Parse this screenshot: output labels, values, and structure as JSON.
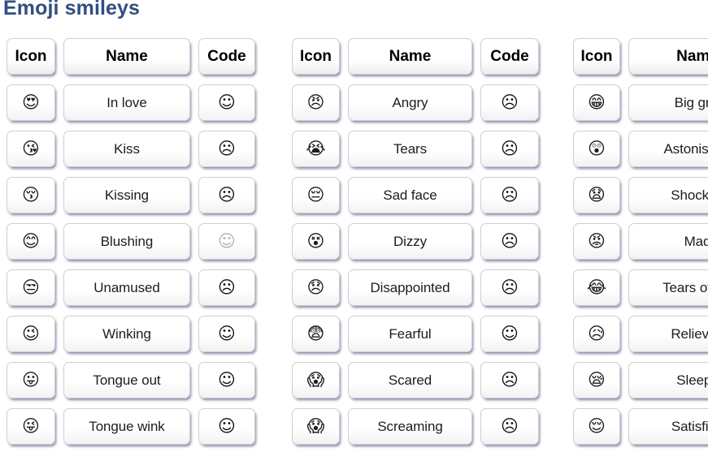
{
  "page": {
    "title": "Emoji smileys",
    "title_color": "#2f4f7f",
    "background": "#ffffff"
  },
  "columns": {
    "icon_header": "Icon",
    "name_header": "Name",
    "code_header": "Code"
  },
  "tables": [
    {
      "headers": {
        "icon": "Icon",
        "name": "Name",
        "code": "Code"
      },
      "show_code": true,
      "rows": [
        {
          "icon": "😍",
          "icon_name": "smiling-face-with-heart-eyes-icon",
          "name": "In love",
          "code": "☺",
          "code_name": "code-glyph-in-love",
          "faint": false
        },
        {
          "icon": "😘",
          "icon_name": "face-blowing-a-kiss-icon",
          "name": "Kiss",
          "code": "☹",
          "code_name": "code-glyph-kiss",
          "faint": false
        },
        {
          "icon": "😚",
          "icon_name": "kissing-face-closed-eyes-icon",
          "name": "Kissing",
          "code": "☹",
          "code_name": "code-glyph-kissing",
          "faint": false
        },
        {
          "icon": "😊",
          "icon_name": "smiling-face-blushing-icon",
          "name": "Blushing",
          "code": "☺",
          "code_name": "code-glyph-blushing",
          "faint": true
        },
        {
          "icon": "😒",
          "icon_name": "unamused-face-icon",
          "name": "Unamused",
          "code": "☹",
          "code_name": "code-glyph-unamused",
          "faint": false
        },
        {
          "icon": "😉",
          "icon_name": "winking-face-icon",
          "name": "Winking",
          "code": "☺",
          "code_name": "code-glyph-winking",
          "faint": false
        },
        {
          "icon": "😛",
          "icon_name": "face-with-tongue-icon",
          "name": "Tongue out",
          "code": "☺",
          "code_name": "code-glyph-tongue-out",
          "faint": false
        },
        {
          "icon": "😜",
          "icon_name": "winking-face-with-tongue-icon",
          "name": "Tongue wink",
          "code": "☺",
          "code_name": "code-glyph-tongue-wink",
          "faint": false
        }
      ]
    },
    {
      "headers": {
        "icon": "Icon",
        "name": "Name",
        "code": "Code"
      },
      "show_code": true,
      "rows": [
        {
          "icon": "😠",
          "icon_name": "angry-face-icon",
          "name": "Angry",
          "code": "☹",
          "code_name": "code-glyph-angry",
          "faint": false
        },
        {
          "icon": "😭",
          "icon_name": "loudly-crying-face-icon",
          "name": "Tears",
          "code": "☹",
          "code_name": "code-glyph-tears",
          "faint": false
        },
        {
          "icon": "😔",
          "icon_name": "pensive-face-icon",
          "name": "Sad face",
          "code": "☹",
          "code_name": "code-glyph-sad-face",
          "faint": false
        },
        {
          "icon": "😵",
          "icon_name": "dizzy-face-icon",
          "name": "Dizzy",
          "code": "☹",
          "code_name": "code-glyph-dizzy",
          "faint": false
        },
        {
          "icon": "😞",
          "icon_name": "disappointed-face-icon",
          "name": "Disappointed",
          "code": "☹",
          "code_name": "code-glyph-disappointed",
          "faint": false
        },
        {
          "icon": "😨",
          "icon_name": "fearful-face-icon",
          "name": "Fearful",
          "code": "☺",
          "code_name": "code-glyph-fearful",
          "faint": false
        },
        {
          "icon": "😱",
          "icon_name": "face-screaming-in-fear-icon",
          "name": "Scared",
          "code": "☹",
          "code_name": "code-glyph-scared",
          "faint": false
        },
        {
          "icon": "😱",
          "icon_name": "screaming-face-icon",
          "name": "Screaming",
          "code": "☹",
          "code_name": "code-glyph-screaming",
          "faint": false
        }
      ]
    },
    {
      "headers": {
        "icon": "Icon",
        "name": "Name",
        "code": ""
      },
      "show_code": false,
      "rows": [
        {
          "icon": "😁",
          "icon_name": "beaming-face-icon",
          "name": "Big grin",
          "code": "",
          "code_name": "",
          "faint": false
        },
        {
          "icon": "😲",
          "icon_name": "astonished-face-icon",
          "name": "Astonished",
          "code": "",
          "code_name": "",
          "faint": false
        },
        {
          "icon": "😧",
          "icon_name": "anguished-face-icon",
          "name": "Shocked",
          "code": "",
          "code_name": "",
          "faint": false
        },
        {
          "icon": "😡",
          "icon_name": "pouting-face-red-icon",
          "name": "Mad",
          "code": "",
          "code_name": "",
          "faint": false
        },
        {
          "icon": "😂",
          "icon_name": "face-with-tears-of-joy-icon",
          "name": "Tears of joy",
          "code": "",
          "code_name": "",
          "faint": false
        },
        {
          "icon": "😥",
          "icon_name": "sad-but-relieved-face-icon",
          "name": "Relieved",
          "code": "",
          "code_name": "",
          "faint": false
        },
        {
          "icon": "😪",
          "icon_name": "sleepy-face-icon",
          "name": "Sleepy",
          "code": "",
          "code_name": "",
          "faint": false
        },
        {
          "icon": "😌",
          "icon_name": "relieved-face-icon",
          "name": "Satisfied",
          "code": "",
          "code_name": "",
          "faint": false
        }
      ]
    }
  ]
}
